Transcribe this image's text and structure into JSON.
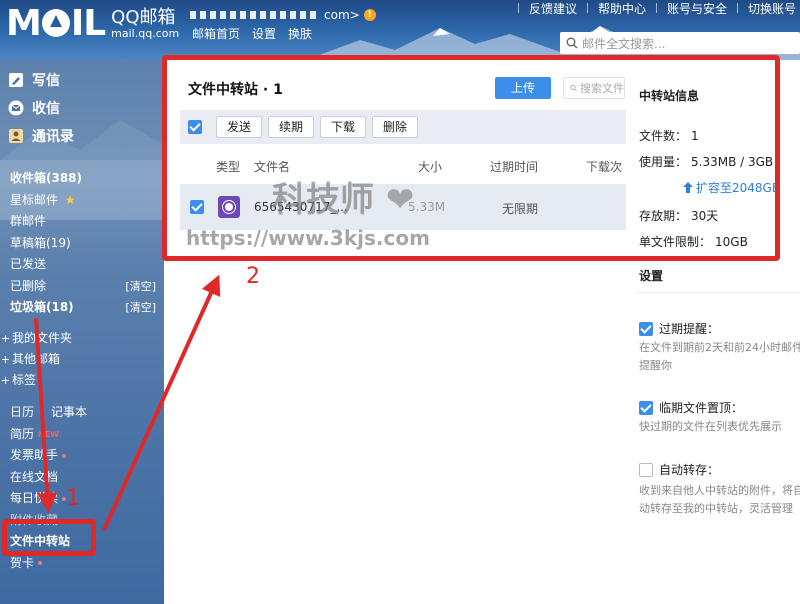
{
  "header": {
    "logo_text": "MOIL",
    "brand_name": "QQ邮箱",
    "brand_domain": "mail.qq.com",
    "account_suffix": "com>",
    "nav": [
      "邮箱首页",
      "设置",
      "换肤"
    ],
    "links": [
      "反馈建议",
      "帮助中心",
      "账号与安全",
      "切换账号"
    ],
    "search_placeholder": "邮件全文搜索..."
  },
  "sidebar": {
    "actions": [
      {
        "label": "写信",
        "icon": "pencil-icon"
      },
      {
        "label": "收信",
        "icon": "envelope-icon"
      },
      {
        "label": "通讯录",
        "icon": "contacts-icon"
      }
    ],
    "folders": [
      {
        "label": "收件箱(388)"
      },
      {
        "label": "星标邮件",
        "star": "★"
      },
      {
        "label": "群邮件"
      },
      {
        "label": "草稿箱(19)"
      },
      {
        "label": "已发送"
      },
      {
        "label": "已删除",
        "action": "[清空]"
      },
      {
        "label": "垃圾箱(18)",
        "action": "[清空]"
      }
    ],
    "groups": [
      "我的文件夹",
      "其他邮箱",
      "标签"
    ],
    "apps": [
      "日历",
      "记事本",
      "简历",
      "发票助手",
      "在线文档",
      "每日悦读",
      "附件收藏",
      "文件中转站",
      "贺卡"
    ],
    "new_badge": "NEW"
  },
  "transfer": {
    "title": "文件中转站 · 1",
    "upload_label": "上传",
    "search_placeholder": "搜索文件",
    "toolbar": [
      "发送",
      "续期",
      "下载",
      "删除"
    ],
    "columns": [
      "类型",
      "文件名",
      "大小",
      "过期时间",
      "下载次"
    ],
    "rows": [
      {
        "name": "6565430717_...",
        "size": "5.33M",
        "expire": "无限期"
      }
    ]
  },
  "info": {
    "title": "中转站信息",
    "file_count_label": "文件数：",
    "file_count": "1",
    "usage_label": "使用量：",
    "usage": "5.33MB / 3GB",
    "expand_label": "扩容至2048GB",
    "period_label": "存放期：",
    "period": "30天",
    "limit_label": "单文件限制：",
    "limit": "10GB"
  },
  "settings": {
    "title": "设置",
    "items": [
      {
        "label": "过期提醒：",
        "checked": true,
        "desc": "在文件到期前2天和前24小时邮件提醒你"
      },
      {
        "label": "临期文件置顶：",
        "checked": true,
        "desc": "快过期的文件在列表优先展示"
      },
      {
        "label": "自动转存：",
        "checked": false,
        "desc": "收到来自他人中转站的附件，将自动转存至我的中转站，灵活管理"
      }
    ]
  },
  "annotations": {
    "num1": "1",
    "num2": "2",
    "color": "#e12828"
  },
  "watermark": {
    "line1": "科技师",
    "line2": "https://www.3kjs.com"
  },
  "colors": {
    "accent": "#3d8eea",
    "sidebar": "#4c73a6",
    "header": "#2f6aad"
  }
}
